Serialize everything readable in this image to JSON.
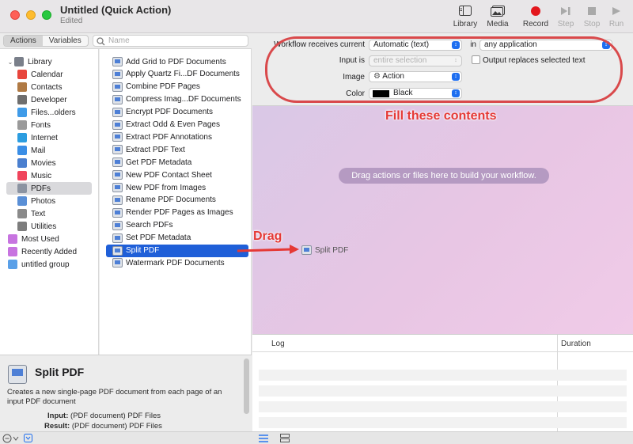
{
  "window": {
    "title": "Untitled (Quick Action)",
    "subtitle": "Edited"
  },
  "toolbar": {
    "library_label": "Library",
    "media_label": "Media",
    "record_label": "Record",
    "step_label": "Step",
    "stop_label": "Stop",
    "run_label": "Run"
  },
  "left_tabs": {
    "actions_label": "Actions",
    "variables_label": "Variables"
  },
  "search": {
    "placeholder": "Name"
  },
  "library": {
    "items": [
      {
        "label": "Library",
        "icon": "library-icon",
        "color": "#7a7f8a"
      },
      {
        "label": "Calendar",
        "icon": "calendar-icon",
        "color": "#e8453c"
      },
      {
        "label": "Contacts",
        "icon": "contacts-icon",
        "color": "#b07a44"
      },
      {
        "label": "Developer",
        "icon": "developer-icon",
        "color": "#6e6e6e"
      },
      {
        "label": "Files...olders",
        "icon": "folder-icon",
        "color": "#3f9be8"
      },
      {
        "label": "Fonts",
        "icon": "fonts-icon",
        "color": "#9a9a9a"
      },
      {
        "label": "Internet",
        "icon": "internet-icon",
        "color": "#2c9de0"
      },
      {
        "label": "Mail",
        "icon": "mail-icon",
        "color": "#3a8ee6"
      },
      {
        "label": "Movies",
        "icon": "movies-icon",
        "color": "#4a7fcf"
      },
      {
        "label": "Music",
        "icon": "music-icon",
        "color": "#f0445c"
      },
      {
        "label": "PDFs",
        "icon": "pdf-icon",
        "color": "#8b93a1"
      },
      {
        "label": "Photos",
        "icon": "photos-icon",
        "color": "#5a8fd6"
      },
      {
        "label": "Text",
        "icon": "text-icon",
        "color": "#8a8a8a"
      },
      {
        "label": "Utilities",
        "icon": "utilities-icon",
        "color": "#7d7d7d"
      },
      {
        "label": "Most Used",
        "icon": "smart-folder-icon",
        "color": "#c774e0"
      },
      {
        "label": "Recently Added",
        "icon": "smart-folder-icon",
        "color": "#c774e0"
      },
      {
        "label": "untitled group",
        "icon": "group-folder-icon",
        "color": "#5aa0e8"
      }
    ]
  },
  "actions": {
    "items": [
      "Add Grid to PDF Documents",
      "Apply Quartz Fi...DF Documents",
      "Combine PDF Pages",
      "Compress Imag...DF Documents",
      "Encrypt PDF Documents",
      "Extract Odd & Even Pages",
      "Extract PDF Annotations",
      "Extract PDF Text",
      "Get PDF Metadata",
      "New PDF Contact Sheet",
      "New PDF from Images",
      "Rename PDF Documents",
      "Render PDF Pages as Images",
      "Search PDFs",
      "Set PDF Metadata",
      "Split PDF",
      "Watermark PDF Documents"
    ],
    "selected": "Split PDF"
  },
  "description": {
    "title": "Split PDF",
    "text": "Creates a new single-page PDF document from each page of an input PDF document",
    "input_label": "Input:",
    "input_value": "(PDF document) PDF Files",
    "result_label": "Result:",
    "result_value": "(PDF document) PDF Files"
  },
  "workflow": {
    "receives_label": "Workflow receives current",
    "receives_value": "Automatic (text)",
    "in_label": "in",
    "in_value": "any application",
    "input_is_label": "Input is",
    "input_is_value": "entire selection",
    "output_replaces_label": "Output replaces selected text",
    "output_replaces_checked": false,
    "image_label": "Image",
    "image_value": "Action",
    "color_label": "Color",
    "color_value": "Black",
    "color_swatch": "#000000",
    "drop_hint": "Drag actions or files here to build your workflow."
  },
  "annotations": {
    "fill_note": "Fill these contents",
    "drag_note": "Drag",
    "dragged_item": "Split PDF",
    "accent": "#e53935"
  },
  "log": {
    "col_log": "Log",
    "col_duration": "Duration"
  }
}
